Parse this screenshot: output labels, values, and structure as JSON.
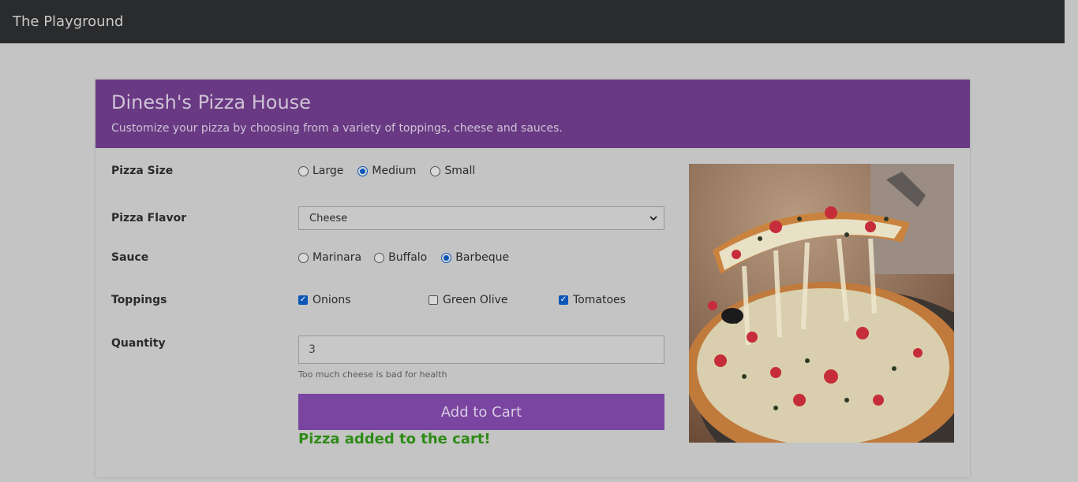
{
  "navbar": {
    "brand": "The Playground"
  },
  "header": {
    "title": "Dinesh's Pizza House",
    "subtitle": "Customize your pizza by choosing from a variety of toppings, cheese and sauces."
  },
  "size": {
    "label": "Pizza Size",
    "options": [
      "Large",
      "Medium",
      "Small"
    ],
    "selected": "Medium"
  },
  "flavor": {
    "label": "Pizza Flavor",
    "selected": "Cheese"
  },
  "sauce": {
    "label": "Sauce",
    "options": [
      "Marinara",
      "Buffalo",
      "Barbeque"
    ],
    "selected": "Barbeque"
  },
  "toppings": {
    "label": "Toppings",
    "items": [
      {
        "label": "Onions",
        "checked": true
      },
      {
        "label": "Green Olive",
        "checked": false
      },
      {
        "label": "Tomatoes",
        "checked": true
      }
    ]
  },
  "quantity": {
    "label": "Quantity",
    "value": "3",
    "hint": "Too much cheese is bad for health"
  },
  "cart": {
    "button_label": "Add to Cart",
    "success_message": "Pizza added to the cart!"
  },
  "colors": {
    "header_bg": "#693983",
    "button_bg": "#7a45a0",
    "success_text": "#2e8b16",
    "navbar_bg": "#2a2b2d"
  },
  "icons": {
    "select_arrow": "chevron-down-icon",
    "image": "pizza-image"
  }
}
